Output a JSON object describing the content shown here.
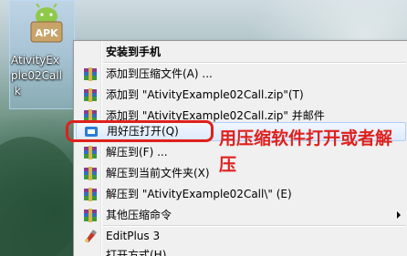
{
  "desktop": {
    "icon": {
      "badge": "APK",
      "label": "AtivityEx\nple02Call\n k"
    }
  },
  "context_menu": {
    "items": [
      {
        "label": "安装到手机",
        "icon": "none",
        "bold": true
      },
      {
        "label": "添加到压缩文件(A) ...",
        "icon": "winrar-archive-icon"
      },
      {
        "label": "添加到 \"AtivityExample02Call.zip\"(T)",
        "icon": "winrar-archive-icon"
      },
      {
        "label": "添加到 \"AtivityExample02Call.zip\" 并邮件",
        "icon": "winrar-archive-icon"
      },
      {
        "label": "用好压打开(Q)",
        "icon": "haozip-open-icon"
      },
      {
        "label": "解压到(F) ...",
        "icon": "winrar-archive-icon"
      },
      {
        "label": "解压到当前文件夹(X)",
        "icon": "winrar-archive-icon"
      },
      {
        "label": "解压到 \"AtivityExample02Call\\\" (E)",
        "icon": "winrar-archive-icon"
      },
      {
        "label": "其他压缩命令",
        "icon": "winrar-archive-icon",
        "submenu": true
      },
      {
        "label": "EditPlus 3",
        "icon": "editplus-icon"
      },
      {
        "label": "打开方式(H)...",
        "icon": "none"
      }
    ]
  },
  "annotation": {
    "text": "用压缩软件打开或者解压",
    "color": "#e0201c"
  }
}
